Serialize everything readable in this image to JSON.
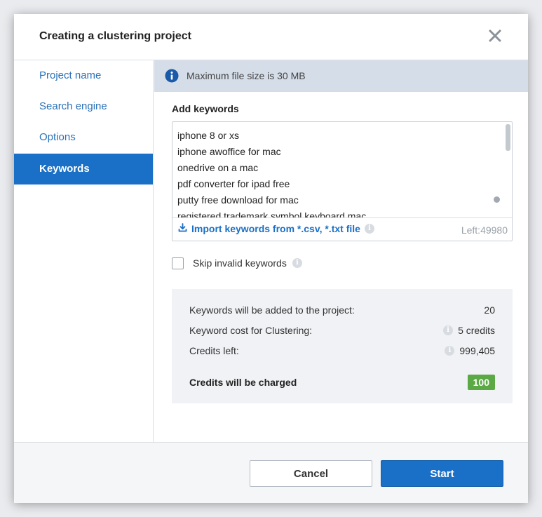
{
  "dialog": {
    "title": "Creating a clustering project",
    "close_icon": "close-icon"
  },
  "sidebar": {
    "items": [
      {
        "label": "Project name",
        "active": false
      },
      {
        "label": "Search engine",
        "active": false
      },
      {
        "label": "Options",
        "active": false
      },
      {
        "label": "Keywords",
        "active": true
      }
    ]
  },
  "info_bar": {
    "icon": "info-icon",
    "text": "Maximum file size is 30 MB"
  },
  "keywords": {
    "label": "Add keywords",
    "lines": [
      "iphone 8 or xs",
      "iphone awoffice for mac",
      "onedrive on a mac",
      "pdf converter for ipad free",
      "putty free download for mac",
      "registered trademark symbol keyboard mac"
    ],
    "import_label": "Import keywords from *.csv, *.txt file",
    "left_label": "Left:49980"
  },
  "skip_invalid": {
    "label": "Skip invalid keywords",
    "checked": false
  },
  "summary": {
    "rows": [
      {
        "label": "Keywords will be added to the project:",
        "value": "20"
      },
      {
        "label": "Keyword cost for Clustering:",
        "value": "5 credits"
      },
      {
        "label": "Credits left:",
        "value": "999,405"
      }
    ],
    "charged_label": "Credits will be charged",
    "charged_value": "100"
  },
  "buttons": {
    "cancel": "Cancel",
    "start": "Start"
  },
  "colors": {
    "accent": "#1a6fc6",
    "badge_green": "#5ba944",
    "info_bar": "#d5dde8"
  }
}
